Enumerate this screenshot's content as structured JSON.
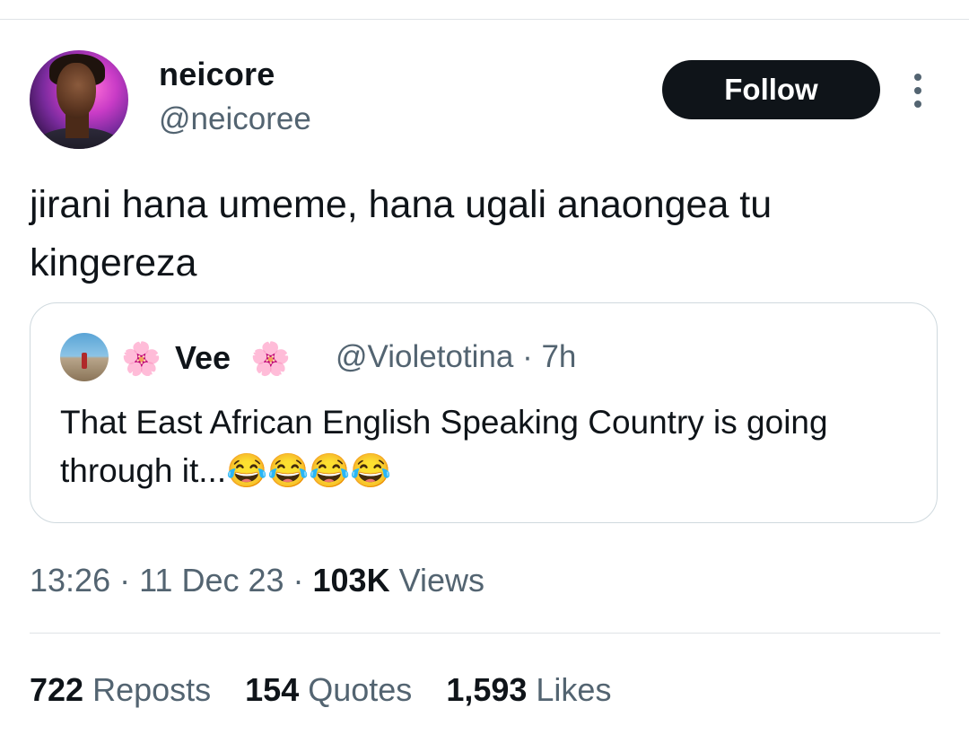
{
  "author": {
    "name": "neicore",
    "handle": "@neicoree"
  },
  "follow_label": "Follow",
  "tweet_text": "jirani hana umeme, hana ugali anaongea tu kingereza",
  "quote": {
    "name": "Vee",
    "name_emoji": "🌸",
    "meta": "@Violetotina · 7h",
    "text": "That East African English Speaking Country is going through it...😂😂😂😂"
  },
  "timestamp": {
    "time_date": "13:26 · 11 Dec 23 · ",
    "views_count": "103K",
    "views_label": " Views"
  },
  "stats": {
    "reposts_count": "722",
    "reposts_label": " Reposts",
    "quotes_count": "154",
    "quotes_label": " Quotes",
    "likes_count": "1,593",
    "likes_label": " Likes"
  },
  "icons": [
    "more-options-icon"
  ],
  "colors": {
    "text_primary": "#0f1419",
    "text_secondary": "#536471",
    "button_bg": "#0f1419",
    "border": "#cfd9de"
  }
}
